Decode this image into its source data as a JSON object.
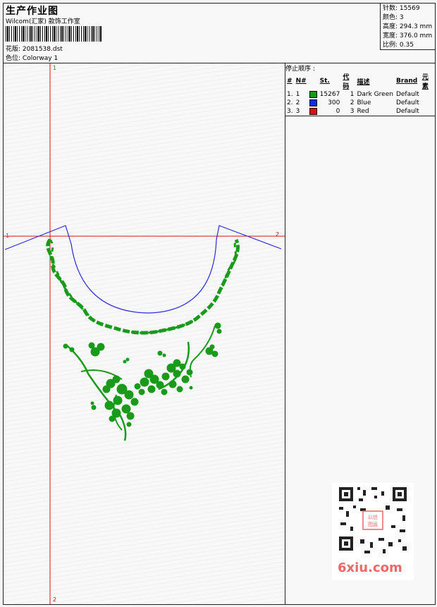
{
  "header": {
    "title": "生产作业图",
    "subtitle": "Wilcom(汇家) 款饰工作室",
    "design_label": "花版:",
    "design_value": "2081538.dst",
    "colorway_label": "色位:",
    "colorway_value": "Colorway 1"
  },
  "stats": [
    {
      "label": "针数:",
      "value": "15569"
    },
    {
      "label": "颜色:",
      "value": "3"
    },
    {
      "label": "高度:",
      "value": "294.3 mm"
    },
    {
      "label": "宽度:",
      "value": "376.0 mm"
    },
    {
      "label": "比例:",
      "value": "0.35"
    }
  ],
  "stop_sequence": {
    "title": "停止顺序 :",
    "columns": [
      "#",
      "N#",
      "St.",
      "代码",
      "描述",
      "Brand",
      "元素"
    ],
    "rows": [
      {
        "idx": "1.",
        "n": "1",
        "color": "#1a9a1a",
        "st": "15267",
        "code": "1",
        "desc": "Dark Green",
        "brand": "Default",
        "elem": ""
      },
      {
        "idx": "2.",
        "n": "2",
        "color": "#1030e0",
        "st": "300",
        "code": "2",
        "desc": "Blue",
        "brand": "Default",
        "elem": ""
      },
      {
        "idx": "3.",
        "n": "3",
        "color": "#e01010",
        "st": "0",
        "code": "3",
        "desc": "Red",
        "brand": "Default",
        "elem": ""
      }
    ]
  },
  "axes": {
    "top": "1",
    "left": "1",
    "right": "2",
    "bottom": "2"
  },
  "watermark": {
    "site": "6xiu.com",
    "stamp": "以信 图运"
  },
  "colors": {
    "green": "#1a9a1a",
    "blue": "#2b2bd8",
    "red": "#e01010"
  }
}
